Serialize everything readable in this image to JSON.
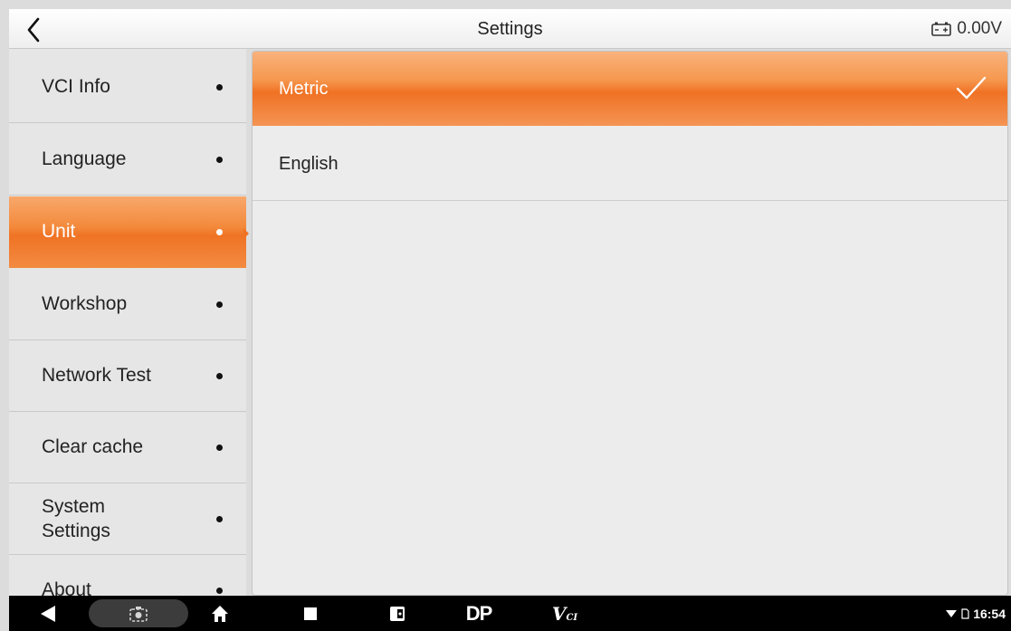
{
  "header": {
    "title": "Settings",
    "voltage": "0.00V"
  },
  "sidebar": {
    "items": [
      {
        "label": "VCI Info"
      },
      {
        "label": "Language"
      },
      {
        "label": "Unit"
      },
      {
        "label": "Workshop"
      },
      {
        "label": "Network Test"
      },
      {
        "label": "Clear cache"
      },
      {
        "label": "System\nSettings"
      },
      {
        "label": "About"
      }
    ],
    "active": "Unit"
  },
  "unit_options": {
    "items": [
      {
        "label": "Metric",
        "selected": true
      },
      {
        "label": "English",
        "selected": false
      }
    ]
  },
  "navbar": {
    "vci_main": "V",
    "vci_sub": "CI",
    "dp_label": "DP",
    "time": "16:54"
  },
  "colors": {
    "accent": "#f07324",
    "background": "#dcdcdc",
    "navbar": "#000000"
  }
}
